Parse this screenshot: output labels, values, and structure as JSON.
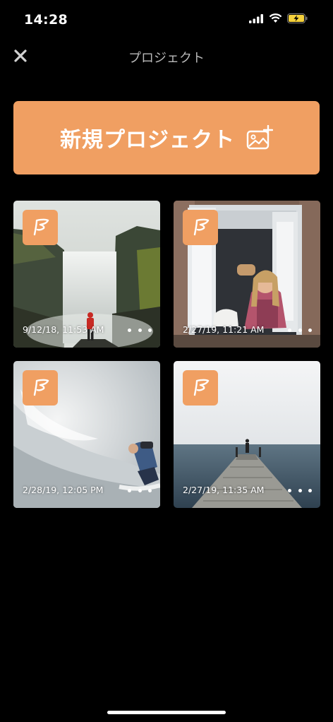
{
  "status_bar": {
    "time": "14:28"
  },
  "nav": {
    "title": "プロジェクト",
    "close_icon": "close-icon"
  },
  "new_project": {
    "label": "新規プロジェクト",
    "icon": "add-image-icon"
  },
  "projects": [
    {
      "date": "9/12/18, 11:53 AM",
      "scene": "waterfall"
    },
    {
      "date": "2/27/19, 11:21 AM",
      "scene": "window"
    },
    {
      "date": "2/28/19, 12:05 PM",
      "scene": "surfer"
    },
    {
      "date": "2/27/19, 11:35 AM",
      "scene": "pier"
    }
  ],
  "colors": {
    "accent": "#f09f62",
    "background": "#000000"
  }
}
